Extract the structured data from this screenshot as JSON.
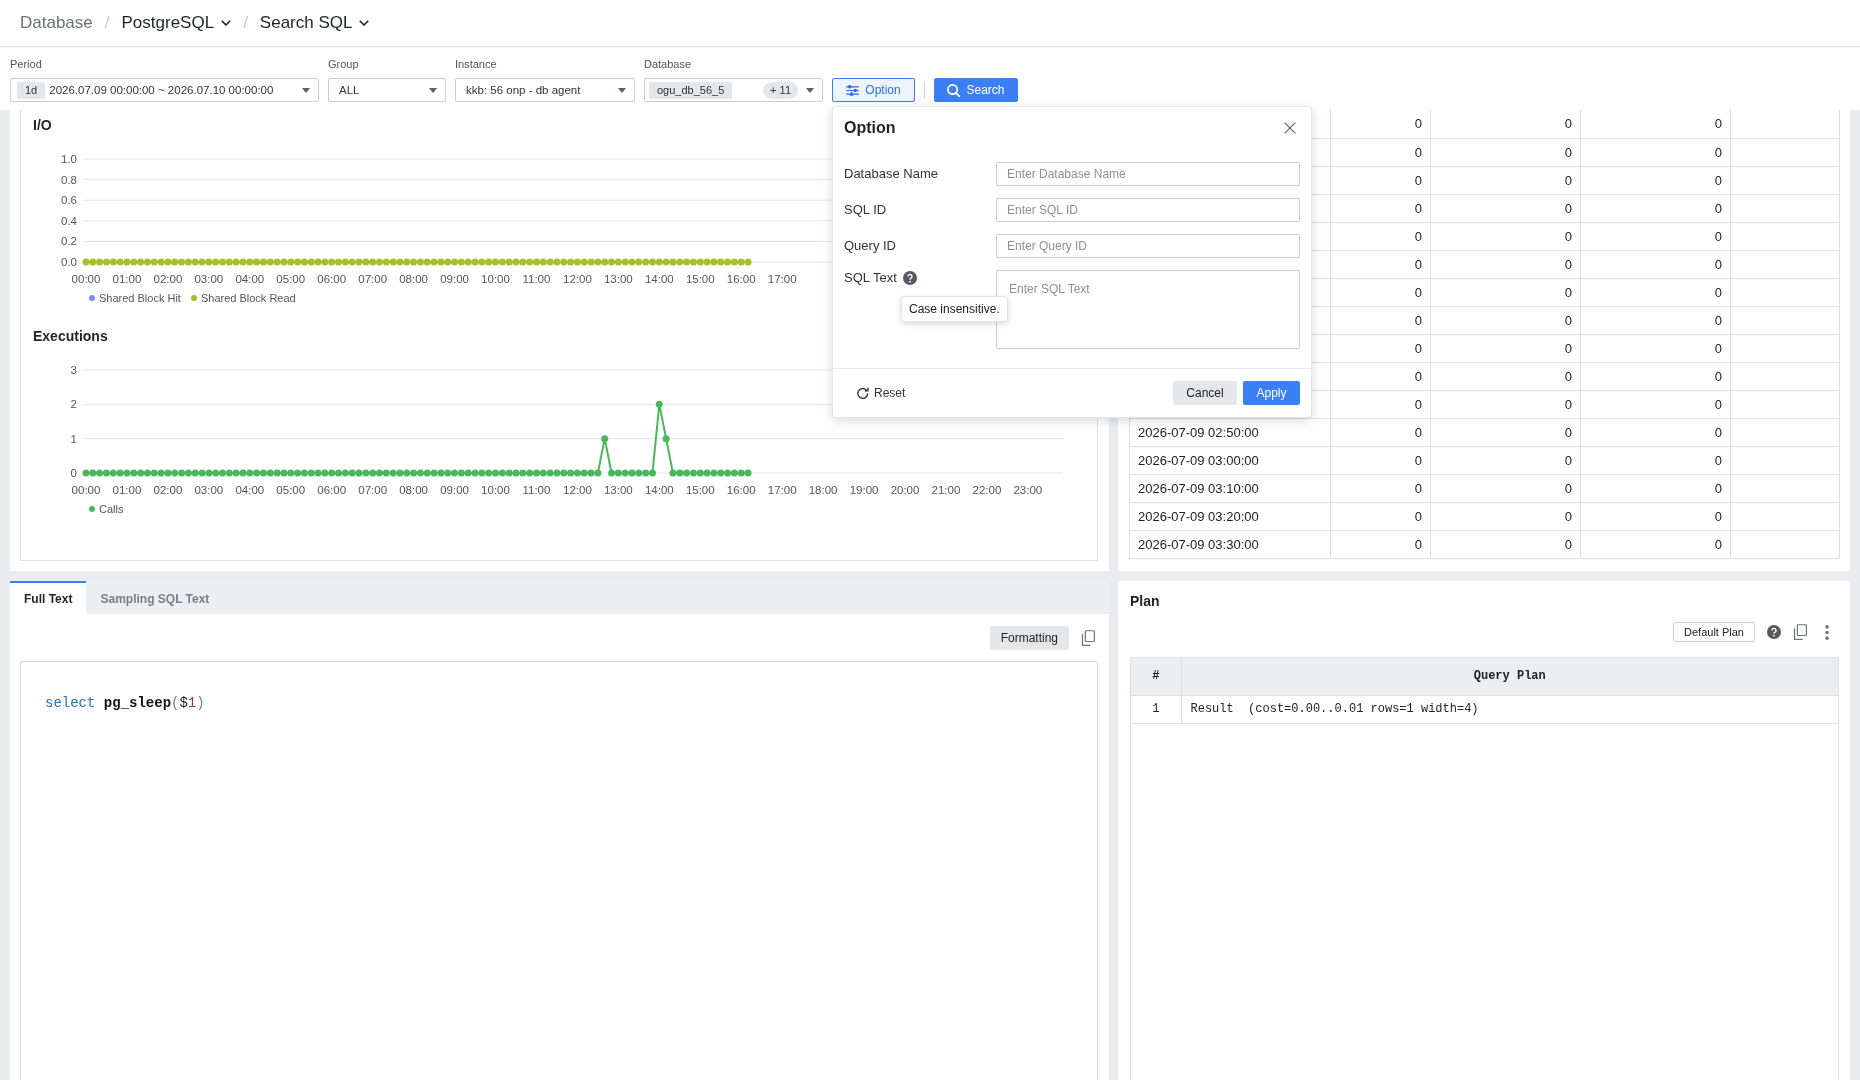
{
  "breadcrumb": [
    {
      "label": "Database",
      "kind": "link"
    },
    {
      "separator": "/",
      "label": "PostgreSQL",
      "kind": "menu"
    },
    {
      "separator": "/",
      "label": "Search SQL",
      "kind": "menu"
    }
  ],
  "filters": [
    {
      "label": "Period",
      "chip": "1d",
      "value": "2026.07.09 00:00:00 ~ 2026.07.10 00:00:00"
    },
    {
      "label": "Group",
      "value": "ALL"
    },
    {
      "label": "Instance",
      "value": "kkb: 56 onp - db agent"
    },
    {
      "label": "Database",
      "chip": "ogu_db_56_5",
      "count": "+ 11"
    }
  ],
  "filter_buttons": [
    {
      "label": "Option",
      "kind": "option"
    },
    {
      "label": "Search",
      "kind": "search"
    }
  ],
  "charts": [
    {
      "chart_data": {
        "type": "line",
        "title": "I/O",
        "grid": true,
        "legend": "bottom-left",
        "x": [
          0,
          10,
          20,
          30,
          40,
          50,
          60,
          70,
          80,
          90,
          100,
          110,
          120,
          130,
          140,
          150,
          160,
          170,
          180,
          190,
          200,
          210,
          220,
          230,
          240,
          250,
          260,
          270,
          280,
          290,
          300,
          310,
          320,
          330,
          340,
          350,
          360,
          370,
          380,
          390,
          400,
          410,
          420,
          430,
          440,
          450,
          460,
          470,
          480,
          490,
          500,
          510,
          520,
          530,
          540,
          550,
          560,
          570,
          580,
          590,
          600,
          610,
          620,
          630,
          640,
          650,
          660,
          670,
          680,
          690,
          700,
          710,
          720,
          730,
          740,
          750,
          760,
          770,
          780,
          790,
          800,
          810,
          820,
          830,
          840,
          850,
          860,
          870,
          880,
          890,
          900,
          910,
          920,
          930,
          940,
          950,
          960,
          970
        ],
        "series": [
          {
            "name": "Shared Block Hit",
            "color": "#7b8cf2",
            "values": [
              null,
              null,
              null,
              null,
              null,
              null,
              null,
              null,
              null,
              null,
              null,
              null,
              null,
              null,
              null,
              null,
              null,
              null,
              null,
              null,
              null,
              null,
              null,
              null,
              null,
              null,
              null,
              null,
              null,
              null,
              null,
              null,
              null,
              null,
              null,
              null,
              null,
              null,
              null,
              null,
              null,
              null,
              null,
              null,
              null,
              null,
              null,
              null,
              null,
              null,
              null,
              null,
              null,
              null,
              null,
              null,
              null,
              null,
              null,
              null,
              null,
              null,
              null,
              null,
              null,
              null,
              null,
              null,
              null,
              null,
              null,
              null,
              null,
              null,
              null,
              null,
              null,
              null,
              null,
              null,
              null,
              null,
              null,
              null,
              null,
              null,
              null,
              null,
              null,
              null,
              null,
              null,
              null,
              null,
              null,
              null,
              null,
              null
            ]
          },
          {
            "name": "Shared Block Read",
            "color": "#a6c02a",
            "marker": "circle",
            "values": [
              0,
              0,
              0,
              0,
              0,
              0,
              0,
              0,
              0,
              0,
              0,
              0,
              0,
              0,
              0,
              0,
              0,
              0,
              0,
              0,
              0,
              0,
              0,
              0,
              0,
              0,
              0,
              0,
              0,
              0,
              0,
              0,
              0,
              0,
              0,
              0,
              0,
              0,
              0,
              0,
              0,
              0,
              0,
              0,
              0,
              0,
              0,
              0,
              0,
              0,
              0,
              0,
              0,
              0,
              0,
              0,
              0,
              0,
              0,
              0,
              0,
              0,
              0,
              0,
              0,
              0,
              0,
              0,
              0,
              0,
              0,
              0,
              0,
              0,
              0,
              0,
              0,
              0,
              0,
              0,
              0,
              0,
              0,
              0,
              0,
              0,
              0,
              0,
              0,
              0,
              0,
              0,
              0,
              0,
              0,
              0,
              0,
              0
            ]
          }
        ],
        "xlim": [
          0,
          1430
        ],
        "ylim": [
          0,
          1
        ],
        "xticks": [
          {
            "value": 0,
            "label": "00:00"
          },
          {
            "value": 60,
            "label": "01:00"
          },
          {
            "value": 120,
            "label": "02:00"
          },
          {
            "value": 180,
            "label": "03:00"
          },
          {
            "value": 240,
            "label": "04:00"
          },
          {
            "value": 300,
            "label": "05:00"
          },
          {
            "value": 360,
            "label": "06:00"
          },
          {
            "value": 420,
            "label": "07:00"
          },
          {
            "value": 480,
            "label": "08:00"
          },
          {
            "value": 540,
            "label": "09:00"
          },
          {
            "value": 600,
            "label": "10:00"
          },
          {
            "value": 660,
            "label": "11:00"
          },
          {
            "value": 720,
            "label": "12:00"
          },
          {
            "value": 780,
            "label": "13:00"
          },
          {
            "value": 840,
            "label": "14:00"
          },
          {
            "value": 900,
            "label": "15:00"
          },
          {
            "value": 960,
            "label": "16:00"
          },
          {
            "value": 1020,
            "label": "17:00"
          }
        ],
        "yticks": [
          {
            "value": 0,
            "label": "0.0"
          },
          {
            "value": 0.2,
            "label": "0.2"
          },
          {
            "value": 0.4,
            "label": "0.4"
          },
          {
            "value": 0.6,
            "label": "0.6"
          },
          {
            "value": 0.8,
            "label": "0.8"
          },
          {
            "value": 1,
            "label": "1.0"
          }
        ]
      }
    },
    {
      "chart_data": {
        "type": "line",
        "title": "Executions",
        "grid": true,
        "legend": "bottom-left",
        "x": [
          0,
          10,
          20,
          30,
          40,
          50,
          60,
          70,
          80,
          90,
          100,
          110,
          120,
          130,
          140,
          150,
          160,
          170,
          180,
          190,
          200,
          210,
          220,
          230,
          240,
          250,
          260,
          270,
          280,
          290,
          300,
          310,
          320,
          330,
          340,
          350,
          360,
          370,
          380,
          390,
          400,
          410,
          420,
          430,
          440,
          450,
          460,
          470,
          480,
          490,
          500,
          510,
          520,
          530,
          540,
          550,
          560,
          570,
          580,
          590,
          600,
          610,
          620,
          630,
          640,
          650,
          660,
          670,
          680,
          690,
          700,
          710,
          720,
          730,
          740,
          750,
          760,
          770,
          780,
          790,
          800,
          810,
          820,
          830,
          840,
          850,
          860,
          870,
          880,
          890,
          900,
          910,
          920,
          930,
          940,
          950,
          960,
          970
        ],
        "series": [
          {
            "name": "Calls",
            "color": "#47b95b",
            "marker": "circle",
            "values": [
              0,
              0,
              0,
              0,
              0,
              0,
              0,
              0,
              0,
              0,
              0,
              0,
              0,
              0,
              0,
              0,
              0,
              0,
              0,
              0,
              0,
              0,
              0,
              0,
              0,
              0,
              0,
              0,
              0,
              0,
              0,
              0,
              0,
              0,
              0,
              0,
              0,
              0,
              0,
              0,
              0,
              0,
              0,
              0,
              0,
              0,
              0,
              0,
              0,
              0,
              0,
              0,
              0,
              0,
              0,
              0,
              0,
              0,
              0,
              0,
              0,
              0,
              0,
              0,
              0,
              0,
              0,
              0,
              0,
              0,
              0,
              0,
              0,
              0,
              0,
              0,
              1,
              0,
              0,
              0,
              0,
              0,
              0,
              0,
              2,
              1,
              0,
              0,
              0,
              0,
              0,
              0,
              0,
              0,
              0,
              0,
              0,
              0
            ]
          }
        ],
        "xlim": [
          0,
          1430
        ],
        "ylim": [
          0,
          3
        ],
        "xticks": [
          {
            "value": 0,
            "label": "00:00"
          },
          {
            "value": 60,
            "label": "01:00"
          },
          {
            "value": 120,
            "label": "02:00"
          },
          {
            "value": 180,
            "label": "03:00"
          },
          {
            "value": 240,
            "label": "04:00"
          },
          {
            "value": 300,
            "label": "05:00"
          },
          {
            "value": 360,
            "label": "06:00"
          },
          {
            "value": 420,
            "label": "07:00"
          },
          {
            "value": 480,
            "label": "08:00"
          },
          {
            "value": 540,
            "label": "09:00"
          },
          {
            "value": 600,
            "label": "10:00"
          },
          {
            "value": 660,
            "label": "11:00"
          },
          {
            "value": 720,
            "label": "12:00"
          },
          {
            "value": 780,
            "label": "13:00"
          },
          {
            "value": 840,
            "label": "14:00"
          },
          {
            "value": 900,
            "label": "15:00"
          },
          {
            "value": 960,
            "label": "16:00"
          },
          {
            "value": 1020,
            "label": "17:00"
          },
          {
            "value": 1080,
            "label": "18:00"
          },
          {
            "value": 1140,
            "label": "19:00"
          },
          {
            "value": 1200,
            "label": "20:00"
          },
          {
            "value": 1260,
            "label": "21:00"
          },
          {
            "value": 1320,
            "label": "22:00"
          },
          {
            "value": 1380,
            "label": "23:00"
          }
        ],
        "yticks": [
          0,
          1,
          2,
          3
        ]
      }
    }
  ],
  "time_table": {
    "rows": [
      {
        "cells": [
          "0",
          "0",
          "0"
        ]
      },
      {
        "cells": [
          "0",
          "0",
          "0"
        ]
      },
      {
        "cells": [
          "0",
          "0",
          "0"
        ]
      },
      {
        "cells": [
          "0",
          "0",
          "0"
        ]
      },
      {
        "cells": [
          "0",
          "0",
          "0"
        ]
      },
      {
        "cells": [
          "0",
          "0",
          "0"
        ]
      },
      {
        "cells": [
          "0",
          "0",
          "0"
        ]
      },
      {
        "cells": [
          "0",
          "0",
          "0"
        ]
      },
      {
        "cells": [
          "0",
          "0",
          "0"
        ]
      },
      {
        "cells": [
          "0",
          "0",
          "0"
        ]
      },
      {
        "cells": [
          "0",
          "0",
          "0"
        ]
      },
      {
        "time": "2026-07-09 02:50:00",
        "cells": [
          "0",
          "0",
          "0"
        ]
      },
      {
        "time": "2026-07-09 03:00:00",
        "cells": [
          "0",
          "0",
          "0"
        ]
      },
      {
        "time": "2026-07-09 03:10:00",
        "cells": [
          "0",
          "0",
          "0"
        ]
      },
      {
        "time": "2026-07-09 03:20:00",
        "cells": [
          "0",
          "0",
          "0"
        ]
      },
      {
        "time": "2026-07-09 03:30:00",
        "cells": [
          "0",
          "0",
          "0"
        ]
      }
    ]
  },
  "sql_text": {
    "tabs": [
      {
        "label": "Full Text",
        "selected": true
      },
      {
        "label": "Sampling SQL Text",
        "selected": false
      }
    ],
    "formatting_button": "Formatting",
    "code": [
      {
        "text": "select",
        "kind": "keyword"
      },
      {
        "text": " pg_sleep",
        "kind": "function"
      },
      {
        "text": "(",
        "kind": "punctuation"
      },
      {
        "text": "$",
        "kind": "plain"
      },
      {
        "text": "1",
        "kind": "number"
      },
      {
        "text": ")",
        "kind": "punctuation"
      }
    ]
  },
  "plan": {
    "title": "Plan",
    "default_plan_button": "Default Plan",
    "columns": [
      "#",
      "Query Plan"
    ],
    "rows": [
      [
        "1",
        "Result  (cost=0.00..0.01 rows=1 width=4)"
      ]
    ]
  },
  "option_dialog": {
    "title": "Option",
    "fields": [
      {
        "label": "Database Name",
        "placeholder": "Enter Database Name",
        "kind": "input"
      },
      {
        "label": "SQL ID",
        "placeholder": "Enter SQL ID",
        "kind": "input"
      },
      {
        "label": "Query ID",
        "placeholder": "Enter Query ID",
        "kind": "input"
      },
      {
        "label": "SQL Text",
        "placeholder": "Enter SQL Text",
        "kind": "textarea",
        "tooltip": "Case insensitive."
      }
    ],
    "reset": "Reset",
    "actions": [
      {
        "label": "Cancel",
        "kind": "cancel"
      },
      {
        "label": "Apply",
        "kind": "apply"
      }
    ]
  }
}
